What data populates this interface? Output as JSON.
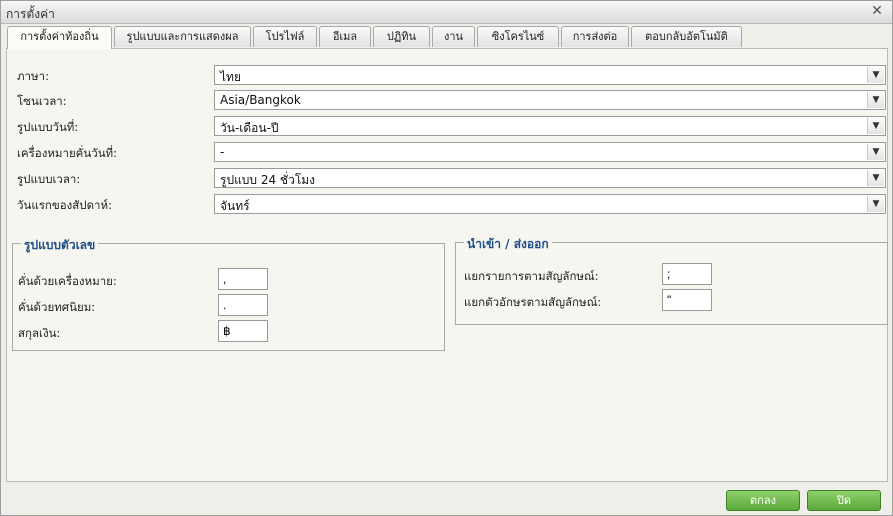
{
  "window": {
    "title": "การตั้งค่า"
  },
  "tabs": [
    {
      "label": "การตั้งค่าท้องถิ่น",
      "active": true
    },
    {
      "label": "รูปแบบและการแสดงผล"
    },
    {
      "label": "โปรไฟล์"
    },
    {
      "label": "อีเมล"
    },
    {
      "label": "ปฏิทิน"
    },
    {
      "label": "งาน"
    },
    {
      "label": "ซิงโครไนซ์"
    },
    {
      "label": "การส่งต่อ"
    },
    {
      "label": "ตอบกลับอัตโนมัติ"
    }
  ],
  "settings": [
    {
      "label": "ภาษา:",
      "value": "ไทย"
    },
    {
      "label": "โซนเวลา:",
      "value": "Asia/Bangkok"
    },
    {
      "label": "รูปแบบวันที่:",
      "value": "วัน-เดือน-ปี"
    },
    {
      "label": "เครื่องหมายคั่นวันที่:",
      "value": "-"
    },
    {
      "label": "รูปแบบเวลา:",
      "value": "รูปแบบ 24 ชั่วโมง"
    },
    {
      "label": "วันแรกของสัปดาห์:",
      "value": "จันทร์"
    }
  ],
  "number_format": {
    "legend": "รูปแบบตัวเลข",
    "fields": [
      {
        "label": "คั่นด้วยเครื่องหมาย:",
        "value": ","
      },
      {
        "label": "คั่นด้วยทศนิยม:",
        "value": "."
      },
      {
        "label": "สกุลเงิน:",
        "value": "฿"
      }
    ]
  },
  "import_export": {
    "legend": "นำเข้า / ส่งออก",
    "fields": [
      {
        "label": "แยกรายการตามสัญลักษณ์:",
        "value": ";"
      },
      {
        "label": "แยกตัวอักษรตามสัญลักษณ์:",
        "value": "\""
      }
    ]
  },
  "buttons": {
    "ok": "ตกลง",
    "close": "ปิด"
  },
  "colors": {
    "accent_blue": "#1e4f8a",
    "button_green": "#5aa83a"
  }
}
